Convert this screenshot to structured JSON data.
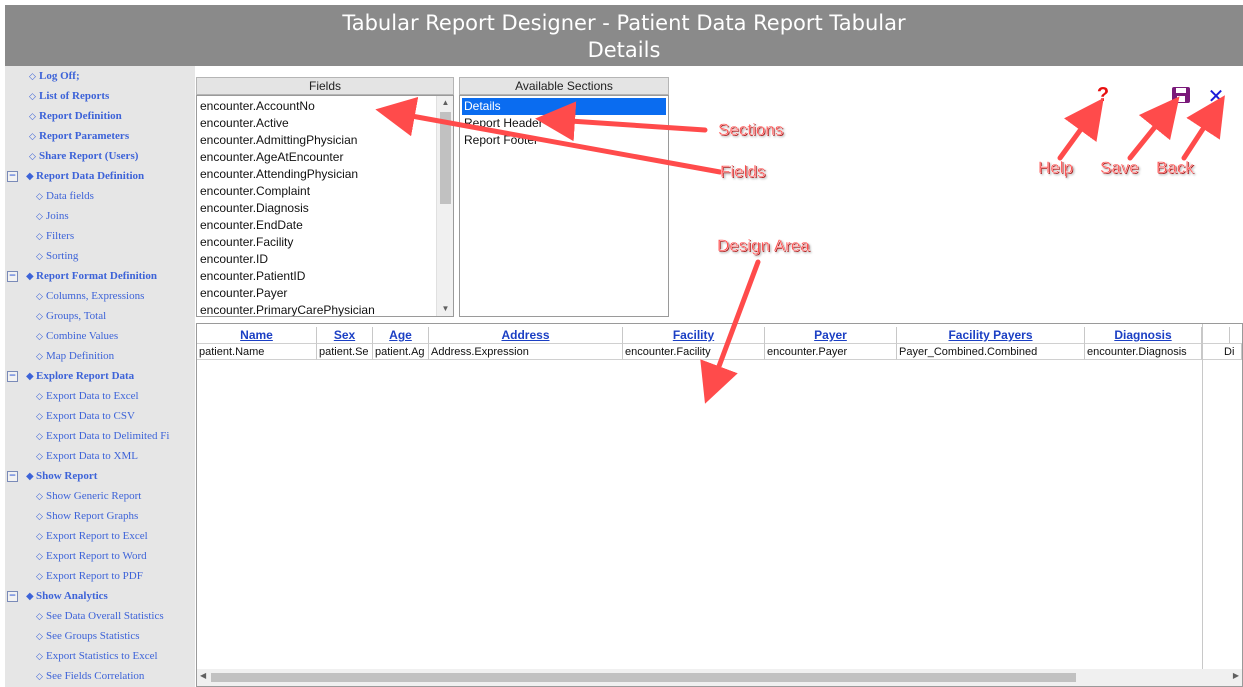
{
  "title": {
    "line1": "Tabular Report Designer - Patient Data Report Tabular",
    "line2": "Details"
  },
  "sidebar": {
    "top_items": [
      {
        "label": "Log Off;"
      },
      {
        "label": "List of Reports"
      },
      {
        "label": "Report Definition"
      },
      {
        "label": "Report Parameters"
      },
      {
        "label": "Share Report (Users)"
      }
    ],
    "groups": [
      {
        "label": "Report Data Definition",
        "toggle": "−",
        "items": [
          "Data fields",
          "Joins",
          "Filters",
          "Sorting"
        ]
      },
      {
        "label": "Report Format Definition",
        "toggle": "−",
        "items": [
          "Columns, Expressions",
          "Groups, Total",
          "Combine Values",
          "Map Definition"
        ]
      },
      {
        "label": "Explore Report Data",
        "toggle": "−",
        "items": [
          "Export Data to Excel",
          "Export Data to CSV",
          "Export Data to Delimited Fi",
          "Export Data to XML"
        ]
      },
      {
        "label": "Show Report",
        "toggle": "−",
        "items": [
          "Show Generic Report",
          "Show Report Graphs",
          "Export Report to Excel",
          "Export Report to Word",
          "Export Report to PDF"
        ]
      },
      {
        "label": "Show Analytics",
        "toggle": "−",
        "items": [
          "See Data Overall Statistics",
          "See Groups Statistics",
          "Export Statistics to Excel",
          "See Fields Correlation"
        ]
      }
    ]
  },
  "fields_panel": {
    "header": "Fields",
    "items": [
      "encounter.AccountNo",
      "encounter.Active",
      "encounter.AdmittingPhysician",
      "encounter.AgeAtEncounter",
      "encounter.AttendingPhysician",
      "encounter.Complaint",
      "encounter.Diagnosis",
      "encounter.EndDate",
      "encounter.Facility",
      "encounter.ID",
      "encounter.PatientID",
      "encounter.Payer",
      "encounter.PrimaryCarePhysician"
    ]
  },
  "sections_panel": {
    "header": "Available Sections",
    "items": [
      "Details",
      "Report Header",
      "Report Footer"
    ],
    "selected": "Details"
  },
  "toolbar": {
    "help_glyph": "?",
    "save_glyph": "💾",
    "back_glyph": "✕",
    "help_color": "#e81010",
    "save_color": "#7a1a7a",
    "back_color": "#1a1ad8"
  },
  "grid": {
    "columns": [
      {
        "header": "Name",
        "cell": "patient.Name"
      },
      {
        "header": "Sex",
        "cell": "patient.Se"
      },
      {
        "header": "Age",
        "cell": "patient.Ag"
      },
      {
        "header": "Address",
        "cell": "Address.Expression"
      },
      {
        "header": "Facility",
        "cell": "encounter.Facility"
      },
      {
        "header": "Payer",
        "cell": "encounter.Payer"
      },
      {
        "header": "Facility Payers",
        "cell": "Payer_Combined.Combined"
      },
      {
        "header": "Diagnosis",
        "cell": "encounter.Diagnosis"
      },
      {
        "header": "",
        "cell": "Di"
      }
    ]
  },
  "annotations": {
    "sections": "Sections",
    "fields": "Fields",
    "design_area": "Design Area",
    "help": "Help",
    "save": "Save",
    "back": "Back",
    "color": "#ff4b4b"
  }
}
